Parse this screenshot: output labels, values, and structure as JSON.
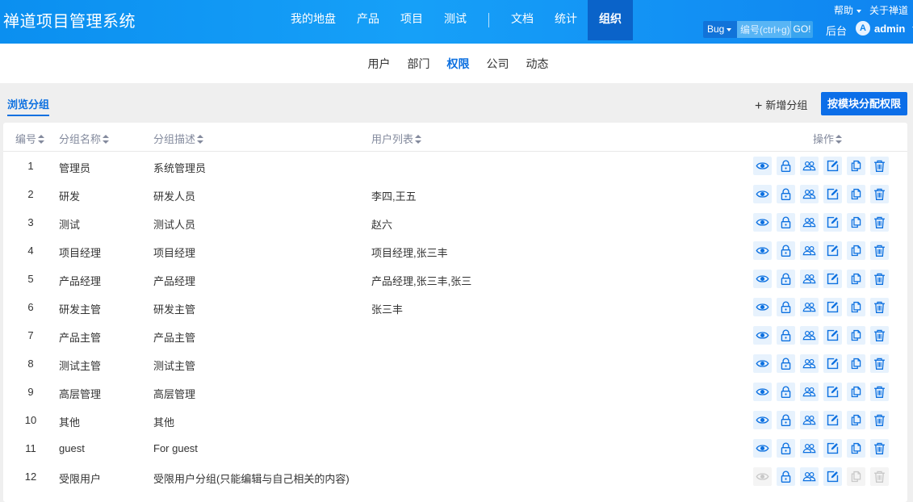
{
  "header": {
    "brand": "禅道项目管理系统",
    "nav": [
      "我的地盘",
      "产品",
      "项目",
      "测试",
      "文档",
      "统计",
      "组织"
    ],
    "help": "帮助",
    "about": "关于禅道",
    "search_type": "Bug",
    "search_placeholder": "编号(ctrl+g)",
    "go": "GO!",
    "backend": "后台",
    "avatar_letter": "A",
    "username": "admin"
  },
  "subnav": [
    "用户",
    "部门",
    "权限",
    "公司",
    "动态"
  ],
  "toolbar": {
    "view_tab": "浏览分组",
    "add_group": "新增分组",
    "assign_button": "按模块分配权限"
  },
  "table": {
    "columns": [
      "编号",
      "分组名称",
      "分组描述",
      "用户列表",
      "操作"
    ],
    "rows": [
      {
        "id": "1",
        "name": "管理员",
        "desc": "系统管理员",
        "users": ""
      },
      {
        "id": "2",
        "name": "研发",
        "desc": "研发人员",
        "users": "李四,王五"
      },
      {
        "id": "3",
        "name": "测试",
        "desc": "测试人员",
        "users": "赵六"
      },
      {
        "id": "4",
        "name": "项目经理",
        "desc": "项目经理",
        "users": "项目经理,张三丰"
      },
      {
        "id": "5",
        "name": "产品经理",
        "desc": "产品经理",
        "users": "产品经理,张三丰,张三"
      },
      {
        "id": "6",
        "name": "研发主管",
        "desc": "研发主管",
        "users": "张三丰"
      },
      {
        "id": "7",
        "name": "产品主管",
        "desc": "产品主管",
        "users": ""
      },
      {
        "id": "8",
        "name": "测试主管",
        "desc": "测试主管",
        "users": ""
      },
      {
        "id": "9",
        "name": "高层管理",
        "desc": "高层管理",
        "users": ""
      },
      {
        "id": "10",
        "name": "其他",
        "desc": "其他",
        "users": ""
      },
      {
        "id": "11",
        "name": "guest",
        "desc": "For guest",
        "users": ""
      },
      {
        "id": "12",
        "name": "受限用户",
        "desc": "受限用户分组(只能编辑与自己相关的内容)",
        "users": ""
      }
    ],
    "action_icons": [
      "eye-icon",
      "lock-icon",
      "users-icon",
      "edit-icon",
      "copy-icon",
      "trash-icon"
    ],
    "accent_color": "#0c70e0",
    "disabled_color": "#c8c8c8"
  }
}
